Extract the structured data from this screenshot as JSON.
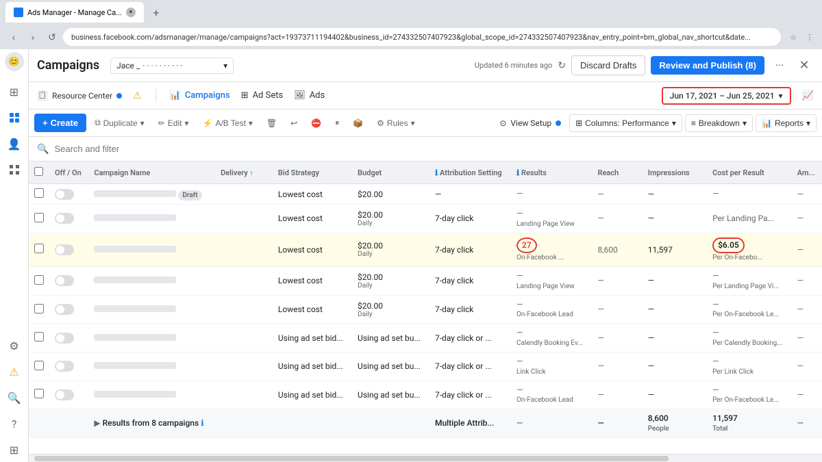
{
  "browser": {
    "tab_title": "Ads Manager - Manage Ca...",
    "address": "business.facebook.com/adsmanager/manage/campaigns?act=19373711194402&business_id=274332507407923&global_scope_id=274332507407923&nav_entry_point=bm_global_nav_shortcut&date...",
    "new_tab_label": "+"
  },
  "header": {
    "campaigns_title": "Campaigns",
    "account_name": "Jace _",
    "account_sub": "...",
    "updated_text": "Updated 6 minutes ago",
    "discard_label": "Discard Drafts",
    "review_label": "Review and Publish (8)"
  },
  "subheader": {
    "resource_center": "Resource Center",
    "campaigns": "Campaigns",
    "ad_sets": "Ad Sets",
    "ads": "Ads",
    "date_range": "Jun 17, 2021 – Jun 25, 2021"
  },
  "toolbar": {
    "create_label": "Create",
    "duplicate_label": "Duplicate",
    "edit_label": "Edit",
    "ab_test_label": "A/B Test",
    "rules_label": "Rules",
    "view_setup_label": "View Setup",
    "columns_label": "Columns: Performance",
    "breakdown_label": "Breakdown",
    "reports_label": "Reports"
  },
  "search": {
    "placeholder": "Search and filter"
  },
  "table": {
    "columns": [
      "",
      "Off / On",
      "Campaign Name",
      "Delivery",
      "Bid Strategy",
      "Budget",
      "Attribution Setting",
      "Results",
      "Reach",
      "Impressions",
      "Cost per Result",
      "Am..."
    ],
    "rows": [
      {
        "id": 1,
        "toggle": "off",
        "name": "",
        "delivery": "Draft",
        "bid_strategy": "Lowest cost",
        "budget": "$20.00",
        "budget_period": "",
        "attribution": "—",
        "results": "—",
        "results_sub": "",
        "reach": "—",
        "impressions": "—",
        "cost_per_result": "—",
        "cost_sub": "",
        "amount": ""
      },
      {
        "id": 2,
        "toggle": "off",
        "name": "",
        "delivery": "",
        "bid_strategy": "Lowest cost",
        "budget": "$20.00",
        "budget_period": "Daily",
        "attribution": "7-day click",
        "results": "—",
        "results_sub": "Landing Page View",
        "reach": "—",
        "impressions": "—",
        "cost_per_result": "Per Landing Pa...",
        "cost_sub": "",
        "amount": ""
      },
      {
        "id": 3,
        "toggle": "off",
        "name": "",
        "delivery": "",
        "bid_strategy": "Lowest cost",
        "budget": "$20.00",
        "budget_period": "Daily",
        "attribution": "7-day click",
        "results": "27",
        "results_sub": "On-Facebook ...",
        "reach": "8,600",
        "impressions": "11,597",
        "cost_per_result": "$6.05",
        "cost_sub": "Per On-Facebo...",
        "amount": "—",
        "highlighted": true
      },
      {
        "id": 4,
        "toggle": "off",
        "name": "",
        "delivery": "",
        "bid_strategy": "Lowest cost",
        "budget": "$20.00",
        "budget_period": "Daily",
        "attribution": "7-day click",
        "results": "—",
        "results_sub": "Landing Page View",
        "reach": "—",
        "impressions": "—",
        "cost_per_result": "—",
        "cost_sub": "Per Landing Page Vi...",
        "amount": "—"
      },
      {
        "id": 5,
        "toggle": "off",
        "name": "",
        "delivery": "",
        "bid_strategy": "Lowest cost",
        "budget": "$20.00",
        "budget_period": "Daily",
        "attribution": "7-day click",
        "results": "—",
        "results_sub": "On-Facebook Lead",
        "reach": "—",
        "impressions": "—",
        "cost_per_result": "—",
        "cost_sub": "Per On-Facebook Le...",
        "amount": "—"
      },
      {
        "id": 6,
        "toggle": "off",
        "name": "",
        "delivery": "",
        "bid_strategy": "Using ad set bid...",
        "budget": "Using ad set bu...",
        "budget_period": "",
        "attribution": "7-day click or ...",
        "results": "—",
        "results_sub": "Calendly Booking Ev...",
        "reach": "—",
        "impressions": "—",
        "cost_per_result": "—",
        "cost_sub": "Per Calendly Booking...",
        "amount": "—"
      },
      {
        "id": 7,
        "toggle": "off",
        "name": "",
        "delivery": "",
        "bid_strategy": "Using ad set bid...",
        "budget": "Using ad set bu...",
        "budget_period": "",
        "attribution": "7-day click or ...",
        "results": "—",
        "results_sub": "Link Click",
        "reach": "—",
        "impressions": "—",
        "cost_per_result": "—",
        "cost_sub": "Per Link Click",
        "amount": "—"
      },
      {
        "id": 8,
        "toggle": "off",
        "name": "",
        "delivery": "",
        "bid_strategy": "Using ad set bid...",
        "budget": "Using ad set bu...",
        "budget_period": "",
        "attribution": "7-day click or ...",
        "results": "—",
        "results_sub": "On-Facebook Lead",
        "reach": "—",
        "impressions": "—",
        "cost_per_result": "—",
        "cost_sub": "Per On-Facebook Le...",
        "amount": "—"
      }
    ],
    "footer": {
      "label": "Results from 8 campaigns",
      "attribution": "Multiple Attrib...",
      "reach": "—",
      "reach_sub": "",
      "impressions": "8,600",
      "impressions_sub": "People",
      "cost_per_result": "11,597",
      "cost_sub": "Total",
      "amount": "—"
    }
  },
  "sidebar_icons": [
    {
      "name": "home-icon",
      "symbol": "⊞"
    },
    {
      "name": "user-icon",
      "symbol": "👤"
    },
    {
      "name": "grid-icon",
      "symbol": "⊞"
    },
    {
      "name": "gear-icon",
      "symbol": "⚙"
    },
    {
      "name": "bell-icon",
      "symbol": "🔔"
    },
    {
      "name": "search-icon",
      "symbol": "🔍"
    }
  ]
}
